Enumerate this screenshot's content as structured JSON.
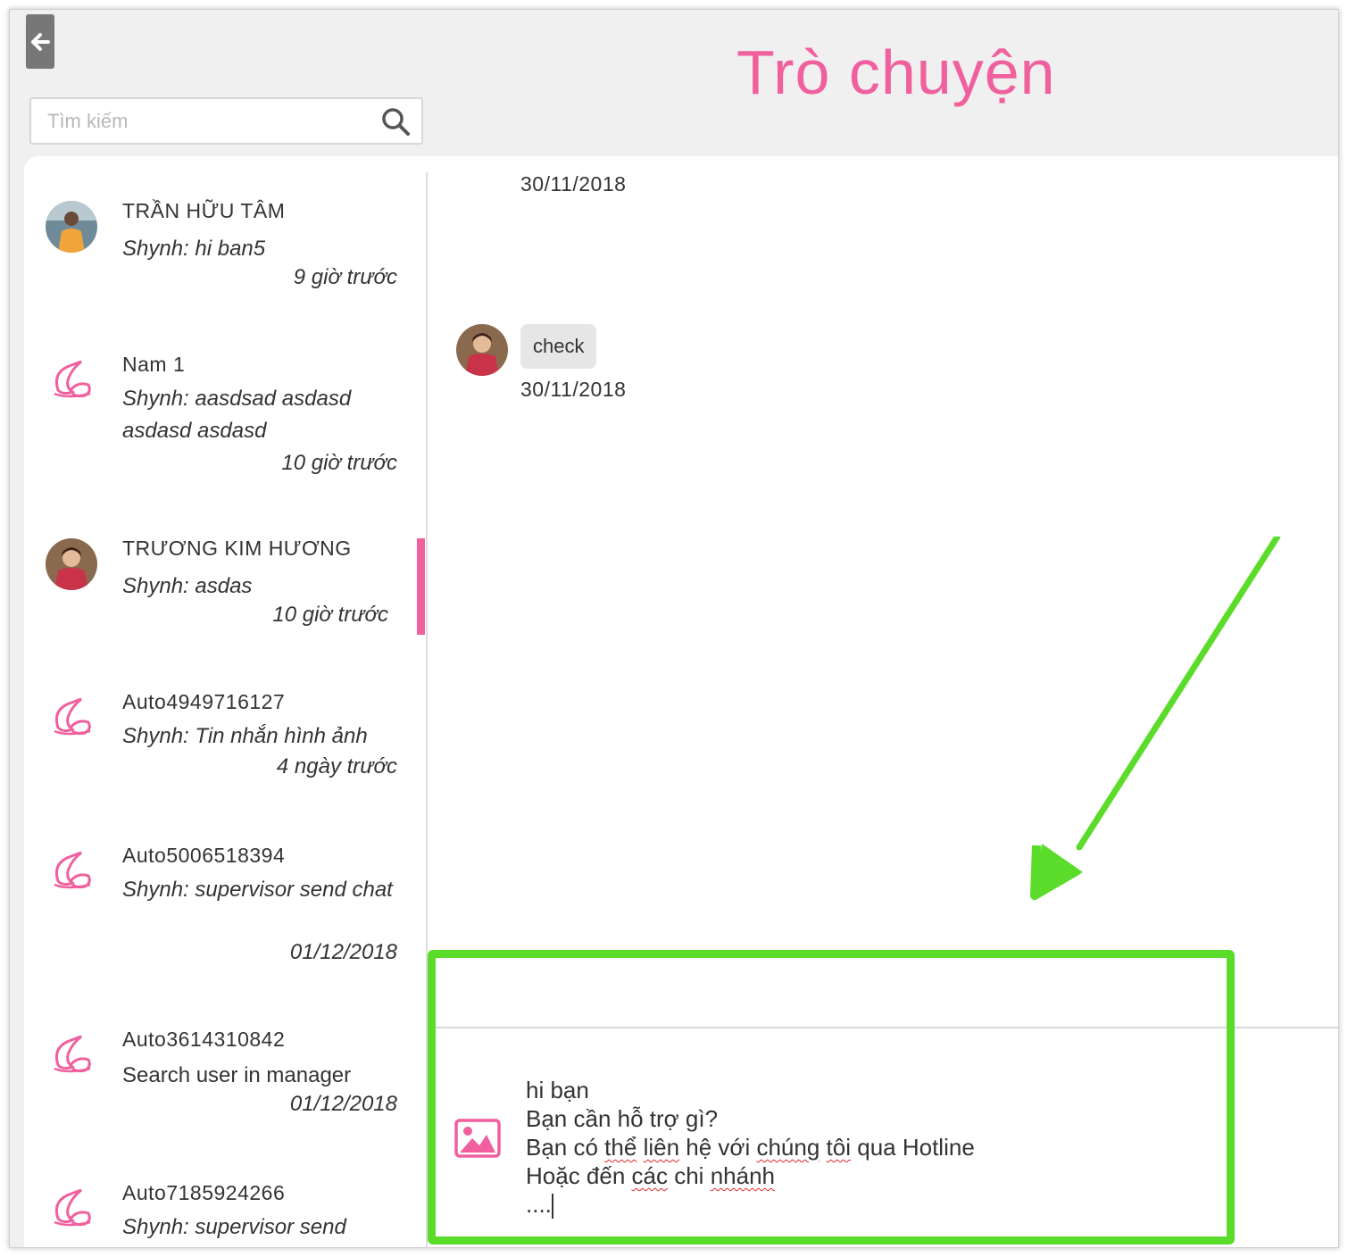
{
  "header": {
    "title": "Trò chuyện",
    "back_icon": "arrow-left-icon"
  },
  "search": {
    "placeholder": "Tìm kiếm",
    "value": "",
    "icon": "search-icon"
  },
  "conversations": [
    {
      "name": "TRẦN HỮU TÂM",
      "message": "Shynh: hi ban5",
      "time": "9 giờ trước",
      "avatar": "photo-male",
      "active": false
    },
    {
      "name": "Nam 1",
      "message": "Shynh: aasdsad asdasd asdasd asdasd",
      "time": "10 giờ trước",
      "avatar": "shynh-logo",
      "active": false
    },
    {
      "name": "TRƯƠNG KIM HƯƠNG",
      "message": "Shynh: asdas",
      "time": "10 giờ trước",
      "avatar": "photo-female",
      "active": true
    },
    {
      "name": "Auto4949716127",
      "message": "Shynh: Tin nhắn hình ảnh",
      "time": "4 ngày trước",
      "avatar": "shynh-logo",
      "active": false
    },
    {
      "name": "Auto5006518394",
      "message": "Shynh: supervisor send chat",
      "time": "01/12/2018",
      "avatar": "shynh-logo",
      "active": false
    },
    {
      "name": "Auto3614310842",
      "message": "Search user in manager",
      "time": "01/12/2018",
      "avatar": "shynh-logo",
      "active": false
    },
    {
      "name": "Auto7185924266",
      "message": "Shynh: supervisor send",
      "time": "",
      "avatar": "shynh-logo",
      "active": false
    }
  ],
  "chat": {
    "messages": [
      {
        "date": "30/11/2018"
      },
      {
        "text": "check",
        "date": "30/11/2018"
      }
    ]
  },
  "composer": {
    "line1": "hi bạn",
    "line2": "Bạn cần hỗ trợ gì?",
    "line3_a": "Bạn có ",
    "line3_b": "thể",
    "line3_c": " ",
    "line3_d": "liên",
    "line3_e": " hệ với ",
    "line3_f": "chúng",
    "line3_g": " ",
    "line3_h": "tôi",
    "line3_i": " qua Hotline",
    "line4_a": "Hoặc đến ",
    "line4_b": "các",
    "line4_c": " chi ",
    "line4_d": "nhánh",
    "line5": "....",
    "image_icon": "image-icon"
  },
  "colors": {
    "brand_pink": "#f0609e",
    "highlight_green": "#5bdc2a",
    "bubble_gray": "#e6e6e6"
  }
}
